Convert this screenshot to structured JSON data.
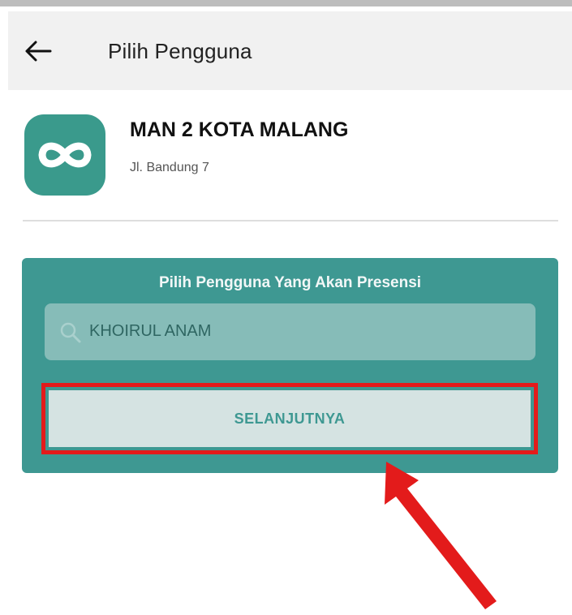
{
  "appbar": {
    "title": "Pilih Pengguna",
    "back_icon": "arrow-left-icon"
  },
  "school": {
    "name": "MAN 2 KOTA MALANG",
    "address": "Jl. Bandung 7",
    "logo_icon": "infinity-icon",
    "logo_color": "#3a9a8c"
  },
  "selection": {
    "title": "Pilih Pengguna Yang Akan Presensi",
    "search_value": "KHOIRUL ANAM",
    "search_icon": "search-icon",
    "next_label": "SELANJUTNYA",
    "card_color": "#3e9892"
  },
  "annotation": {
    "highlight_color": "#e31b1b",
    "arrow_color": "#e31b1b"
  }
}
